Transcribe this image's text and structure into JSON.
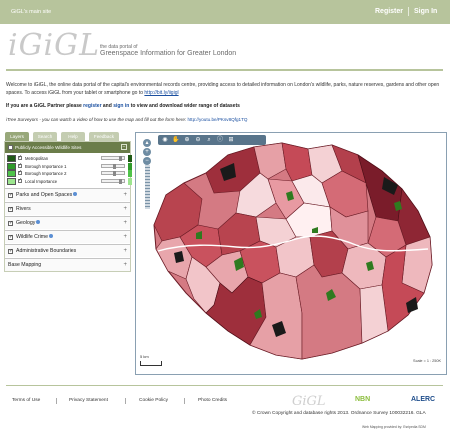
{
  "topbar": {
    "main_site": "GiGL's main site",
    "register": "Register",
    "sign_in": "Sign In"
  },
  "brand": {
    "logo_text": "iGiGL",
    "tagline_small": "the data portal of",
    "tagline_large": "Greenspace Information for Greater London"
  },
  "intro": {
    "text": "Welcome to iGiGL, the online data portal of the capital's environmental records centre, providing access to detailed information on London's wildlife, parks, nature reserves, gardens and other open spaces. To access iGiGL from your tablet or smartphone go to ",
    "link": "http://bit.ly/iigigl"
  },
  "partner": {
    "prefix": "If you are a GiGL Partner please ",
    "register": "register",
    "and": " and ",
    "sign_in": "sign in",
    "suffix": " to view and download wider range of datasets"
  },
  "video": {
    "text": "iTree Surveyors - you can watch a video of how to use the map and fill out the form here: ",
    "link": "http://youtu.be/PKsv8Qfg1TQ"
  },
  "tabs": [
    {
      "label": "Layers"
    },
    {
      "label": "Search"
    },
    {
      "label": "Help"
    },
    {
      "label": "Feedback"
    }
  ],
  "layers_panel": {
    "header": "Publicly Accessible Wildlife Sites",
    "legend": [
      {
        "label": "Metropolitan",
        "color": "#1f5a15",
        "level": 0.75
      },
      {
        "label": "Borough Importance 1",
        "color": "#2f9a2a",
        "level": 0.5
      },
      {
        "label": "Borough Importance 2",
        "color": "#4fc34a",
        "level": 0.5
      },
      {
        "label": "Local Importance",
        "color": "#9ce58e",
        "level": 0.75
      }
    ],
    "sections": [
      {
        "label": "Parks and Open Spaces"
      },
      {
        "label": "Rivers"
      },
      {
        "label": "Geology"
      },
      {
        "label": "Wildlife Crime"
      },
      {
        "label": "Administrative Boundaries"
      }
    ],
    "base_mapping": "Base Mapping"
  },
  "map": {
    "scale_label": "5 km",
    "credit": "Scale = 1 : 250K",
    "colors": {
      "dark": "#7a1c2a",
      "mid": "#c54a57",
      "light": "#e6a0a6",
      "pale": "#f4d1d4",
      "green": "#4a8a2a"
    }
  },
  "footer": {
    "links": [
      {
        "label": "Terms of Use"
      },
      {
        "label": "Privacy Statement"
      },
      {
        "label": "Cookie Policy"
      },
      {
        "label": "Photo Credits"
      }
    ],
    "logo_gigl": "GiGL",
    "logo_nbn": "NBN",
    "logo_alerc": "ALERC",
    "copyright": "© Crown Copyright and database rights 2013. Ordnance Survey 100032216. GLA",
    "web_mapping": "Web Mapping provided by:    Esripedia SDM"
  }
}
